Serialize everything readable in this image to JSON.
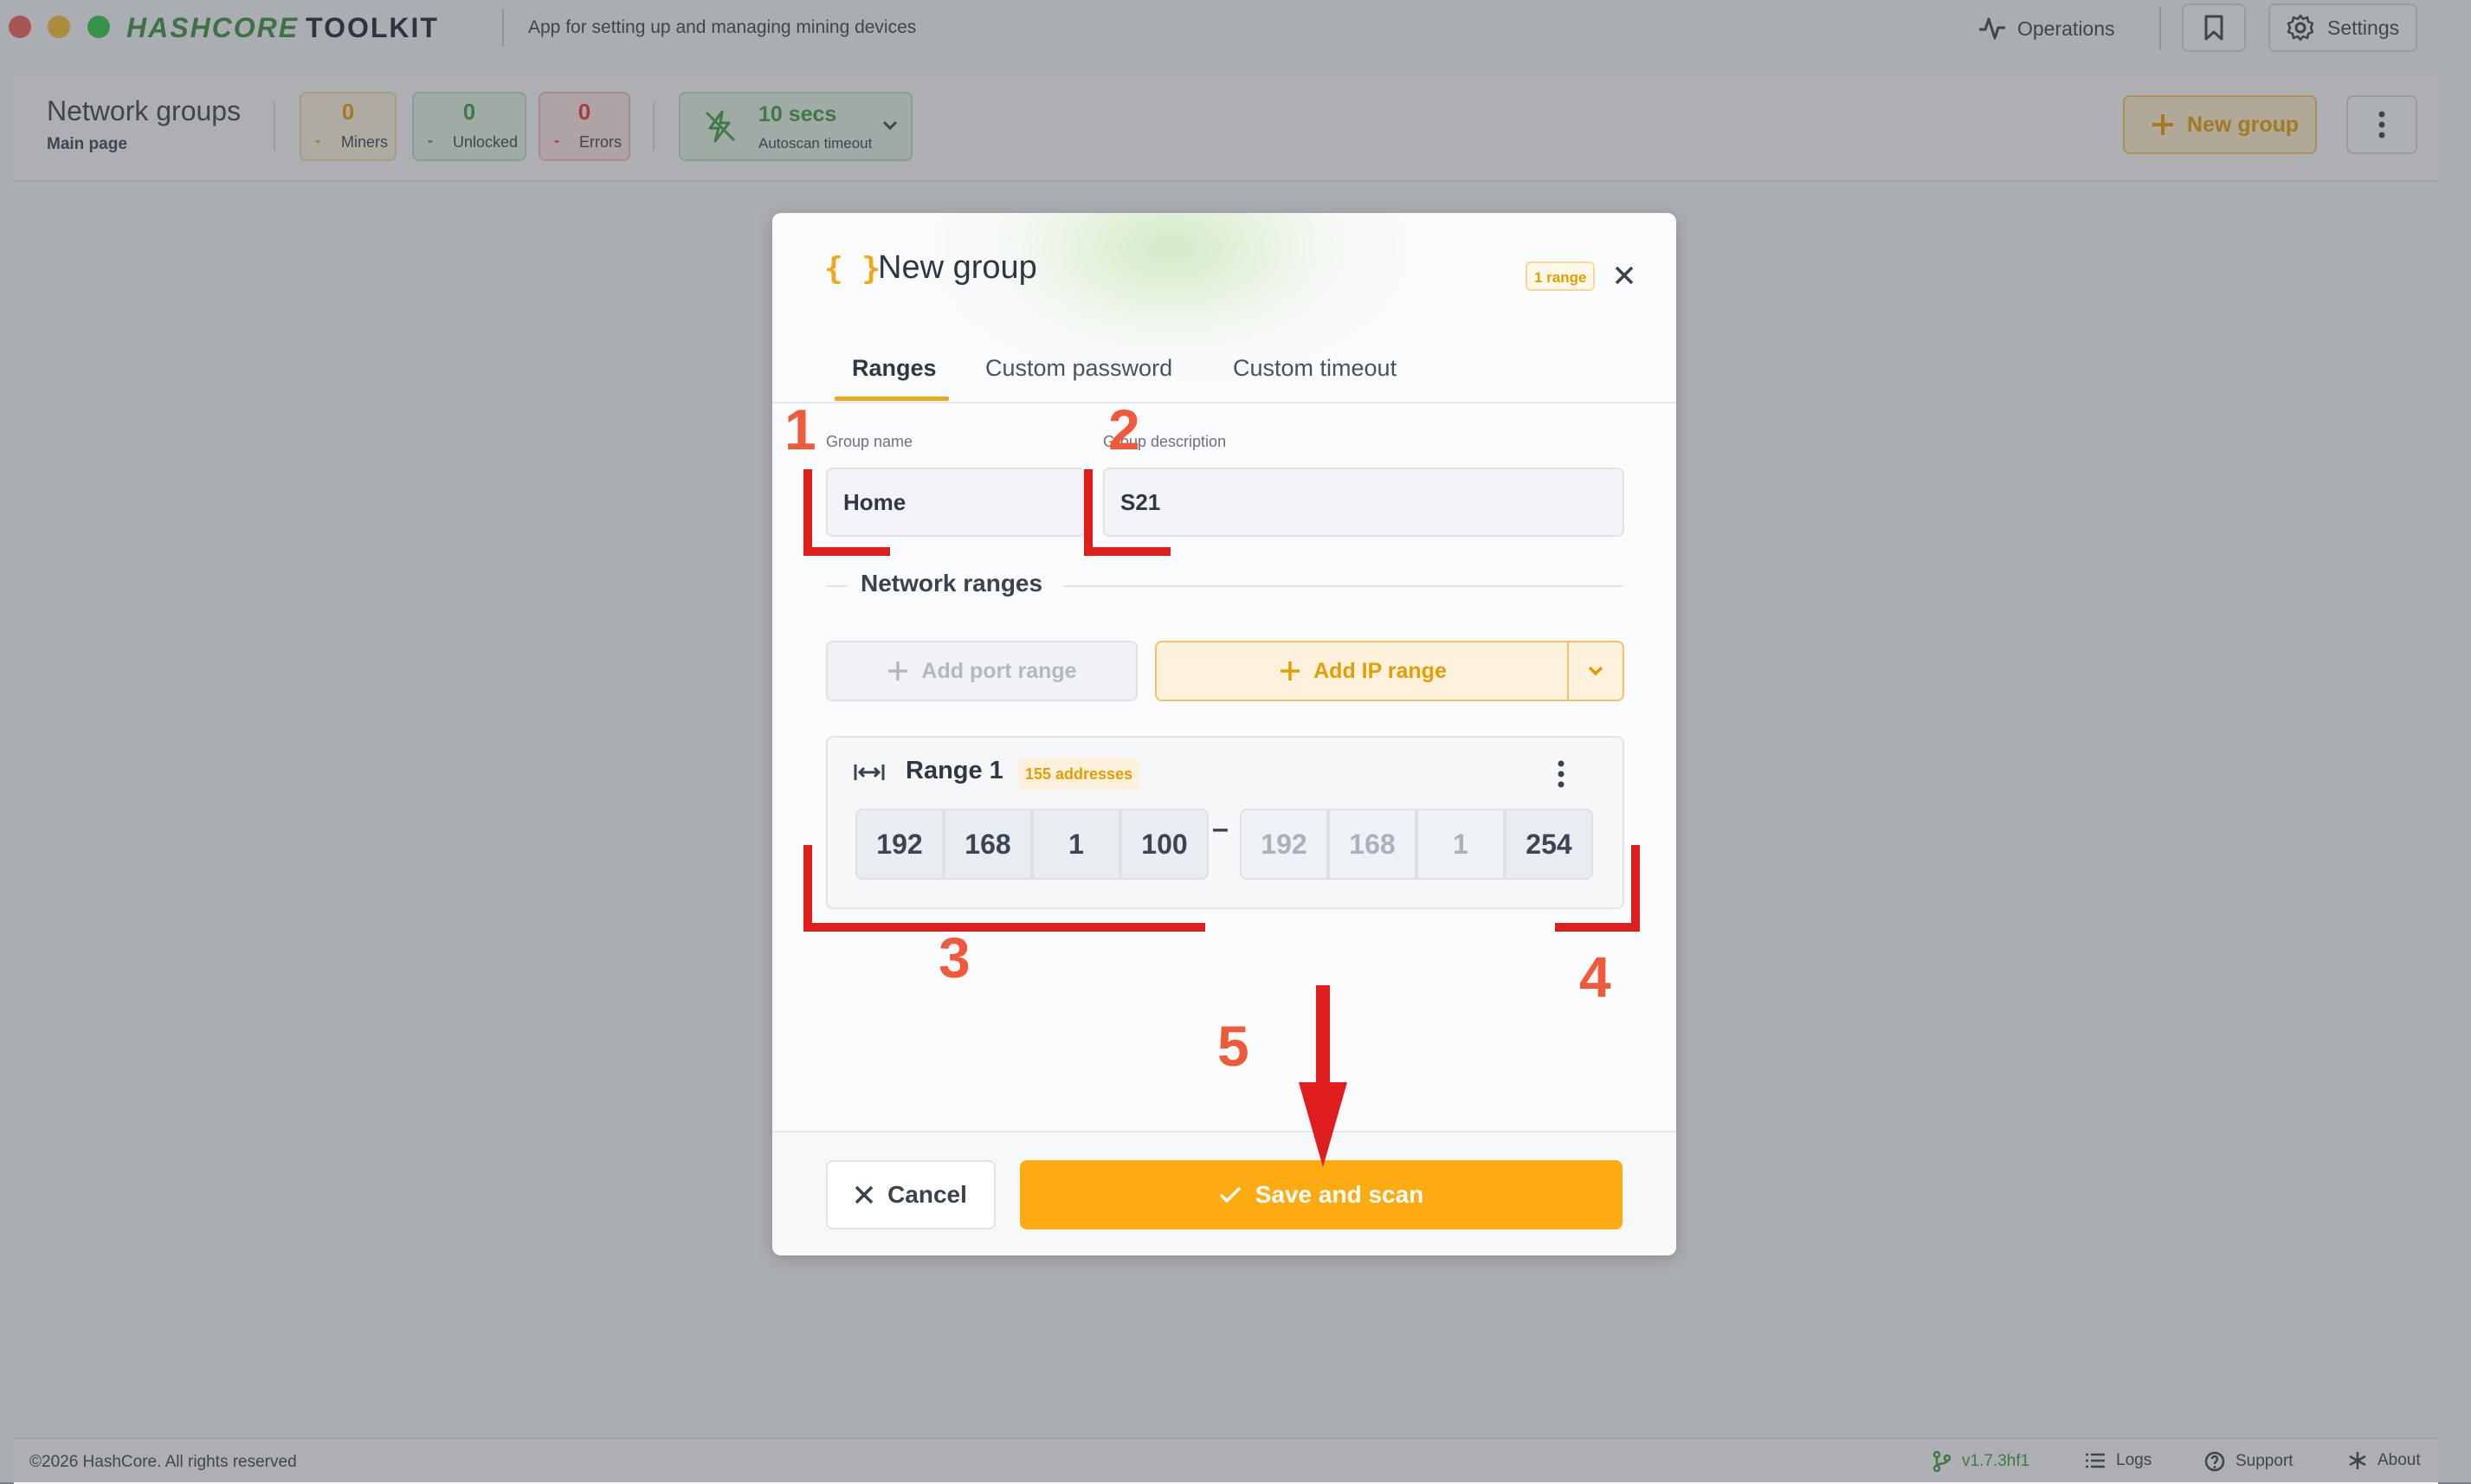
{
  "app": {
    "logo_main": "HASHCORE",
    "logo_sub": "TOOLKIT",
    "tagline": "App for setting up and managing mining devices",
    "operations_label": "Operations",
    "settings_label": "Settings"
  },
  "header": {
    "title": "Network groups",
    "subtitle": "Main page",
    "stats": [
      {
        "value": "0",
        "delta": "-",
        "label": "Miners",
        "color": "#e69d00"
      },
      {
        "value": "0",
        "delta": "-",
        "label": "Unlocked",
        "color": "#3a9b3e"
      },
      {
        "value": "0",
        "delta": "-",
        "label": "Errors",
        "color": "#e53935"
      }
    ],
    "autoscan": {
      "value": "10 secs",
      "label": "Autoscan timeout"
    },
    "new_group_label": "New group"
  },
  "modal": {
    "icon": "{ }",
    "title": "New group",
    "badge": "1 range",
    "tabs": [
      {
        "label": "Ranges",
        "active": true
      },
      {
        "label": "Custom password",
        "active": false
      },
      {
        "label": "Custom timeout",
        "active": false
      }
    ],
    "group_name_label": "Group name",
    "group_name_value": "Home",
    "group_desc_label": "Group description",
    "group_desc_value": "S21",
    "section_title": "Network ranges",
    "add_port_range": "Add port range",
    "add_ip_range": "Add IP range",
    "range": {
      "title": "Range 1",
      "badge": "155 addresses",
      "start": [
        "192",
        "168",
        "1",
        "100"
      ],
      "dash": "–",
      "end": [
        "192",
        "168",
        "1",
        "254"
      ]
    },
    "cancel_label": "Cancel",
    "save_label": "Save and scan"
  },
  "annotations": [
    "1",
    "2",
    "3",
    "4",
    "5"
  ],
  "footer": {
    "copyright": "©2026 HashCore. All rights reserved",
    "version": "v1.7.3hf1",
    "logs": "Logs",
    "support": "Support",
    "about": "About"
  },
  "colors": {
    "accent": "#fdab10",
    "success": "#3a9b3e",
    "error": "#e53935",
    "annotation": "#e01d1d"
  }
}
